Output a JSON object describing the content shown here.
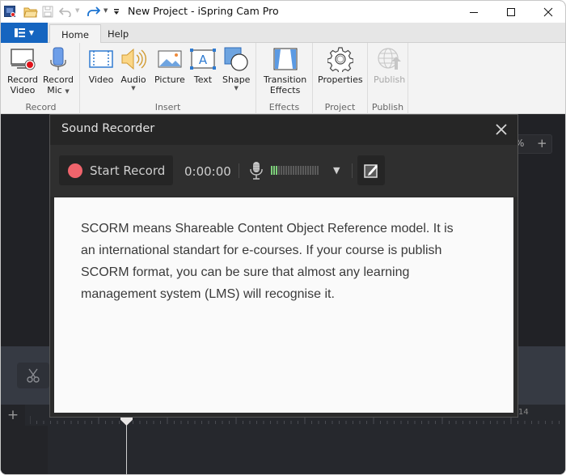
{
  "window": {
    "title": "New Project - iSpring Cam Pro",
    "controls": {
      "minimize": "—",
      "maximize": "☐",
      "close": "✕"
    }
  },
  "quick_access": {
    "items": [
      "app-icon",
      "open-folder-icon",
      "save-icon",
      "undo-icon",
      "redo-icon",
      "customize-icon"
    ]
  },
  "ribbon": {
    "file_menu_icon": "menu-icon",
    "tabs": [
      {
        "label": "Home",
        "active": true
      },
      {
        "label": "Help",
        "active": false
      }
    ],
    "groups": [
      {
        "label": "Record",
        "buttons": [
          {
            "label_line1": "Record",
            "label_line2": "Video",
            "icon": "record-video-icon"
          },
          {
            "label_line1": "Record",
            "label_line2": "Mic",
            "icon": "microphone-icon",
            "dropdown": true
          }
        ]
      },
      {
        "label": "Insert",
        "buttons": [
          {
            "label": "Video",
            "icon": "film-icon"
          },
          {
            "label": "Audio",
            "icon": "speaker-icon",
            "dropdown": true
          },
          {
            "label": "Picture",
            "icon": "picture-icon"
          },
          {
            "label": "Text",
            "icon": "text-box-icon"
          },
          {
            "label": "Shape",
            "icon": "shape-icon",
            "dropdown": true
          }
        ]
      },
      {
        "label": "Effects",
        "buttons": [
          {
            "label_line1": "Transition",
            "label_line2": "Effects",
            "icon": "transition-icon"
          }
        ]
      },
      {
        "label": "Project",
        "buttons": [
          {
            "label": "Properties",
            "icon": "gear-icon"
          }
        ]
      },
      {
        "label": "Publish",
        "buttons": [
          {
            "label": "Publish",
            "icon": "globe-upload-icon",
            "disabled": true
          }
        ]
      }
    ]
  },
  "workspace": {
    "zoom_suffix": "%",
    "zoom_plus": "+",
    "add_track": "+",
    "ruler_label": "14"
  },
  "sound_recorder": {
    "title": "Sound Recorder",
    "close": "✕",
    "start_record_label": "Start Record",
    "timer": "0:00:00",
    "level_meter": {
      "total_bars": 20,
      "active_bars": 3
    },
    "device_dropdown": "▼",
    "script_text": "SCORM means Shareable Content Object Reference model. It is an international standart for e-courses. If your course is publish SCORM format, you can be sure that almost any learning management system (LMS) will recognise it.",
    "colors": {
      "record_dot": "#f0646c",
      "meter_active": "#7ed07b",
      "meter_inactive": "#5a5a5a"
    }
  }
}
